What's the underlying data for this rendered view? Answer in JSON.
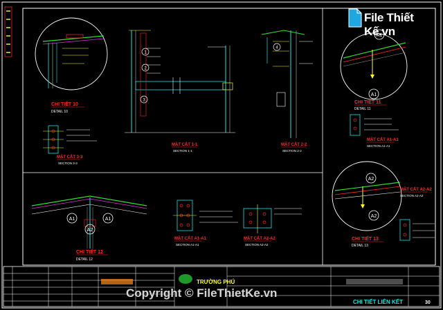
{
  "watermark": {
    "logo_text": "File Thiết Kế.vn",
    "copyright": "Copyright © FileThietKe.vn"
  },
  "colors": {
    "background": "#000000",
    "frame": "#ffffff",
    "title_red": "#ff2a2a",
    "cyan": "#19e6e6",
    "yellow": "#ffff33",
    "green": "#33dd33",
    "magenta": "#dd33dd",
    "grey": "#8a8a8a"
  },
  "details": [
    {
      "title": "CHI TIẾT 10",
      "sub": "DETAIL 10"
    },
    {
      "title": "CHI TIẾT 11",
      "sub": "DETAIL 11"
    },
    {
      "title": "CHI TIẾT 12",
      "sub": "DETAIL 12"
    },
    {
      "title": "CHI TIẾT 13",
      "sub": "DETAIL 13"
    }
  ],
  "sections": [
    {
      "title": "MẶT CẮT 1-1",
      "sub": "SECTION 1-1"
    },
    {
      "title": "MẶT CẮT 2-2",
      "sub": "SECTION 2-2"
    },
    {
      "title": "MẶT CẮT 3-3",
      "sub": "SECTION 3-3"
    },
    {
      "title": "MẶT CẮT A1-A1",
      "sub": "SECTION A1-A1"
    },
    {
      "title": "MẶT CẮT A2-A2",
      "sub": "SECTION A2-A2"
    },
    {
      "title": "MẶT CẮT A1-A1",
      "sub": "SECTION A1-A1"
    },
    {
      "title": "MẶT CẮT A2-A2",
      "sub": "SECTION A2-A2"
    }
  ],
  "tags": {
    "a1": "A1",
    "a2": "A2",
    "n1": "1",
    "n2": "2",
    "n3": "3",
    "n4": "4"
  },
  "title_block": {
    "company": "TRƯỜNG PHÚ",
    "drawing_title": "CHI TIẾT LIÊN KẾT",
    "sheet_no": "30"
  }
}
